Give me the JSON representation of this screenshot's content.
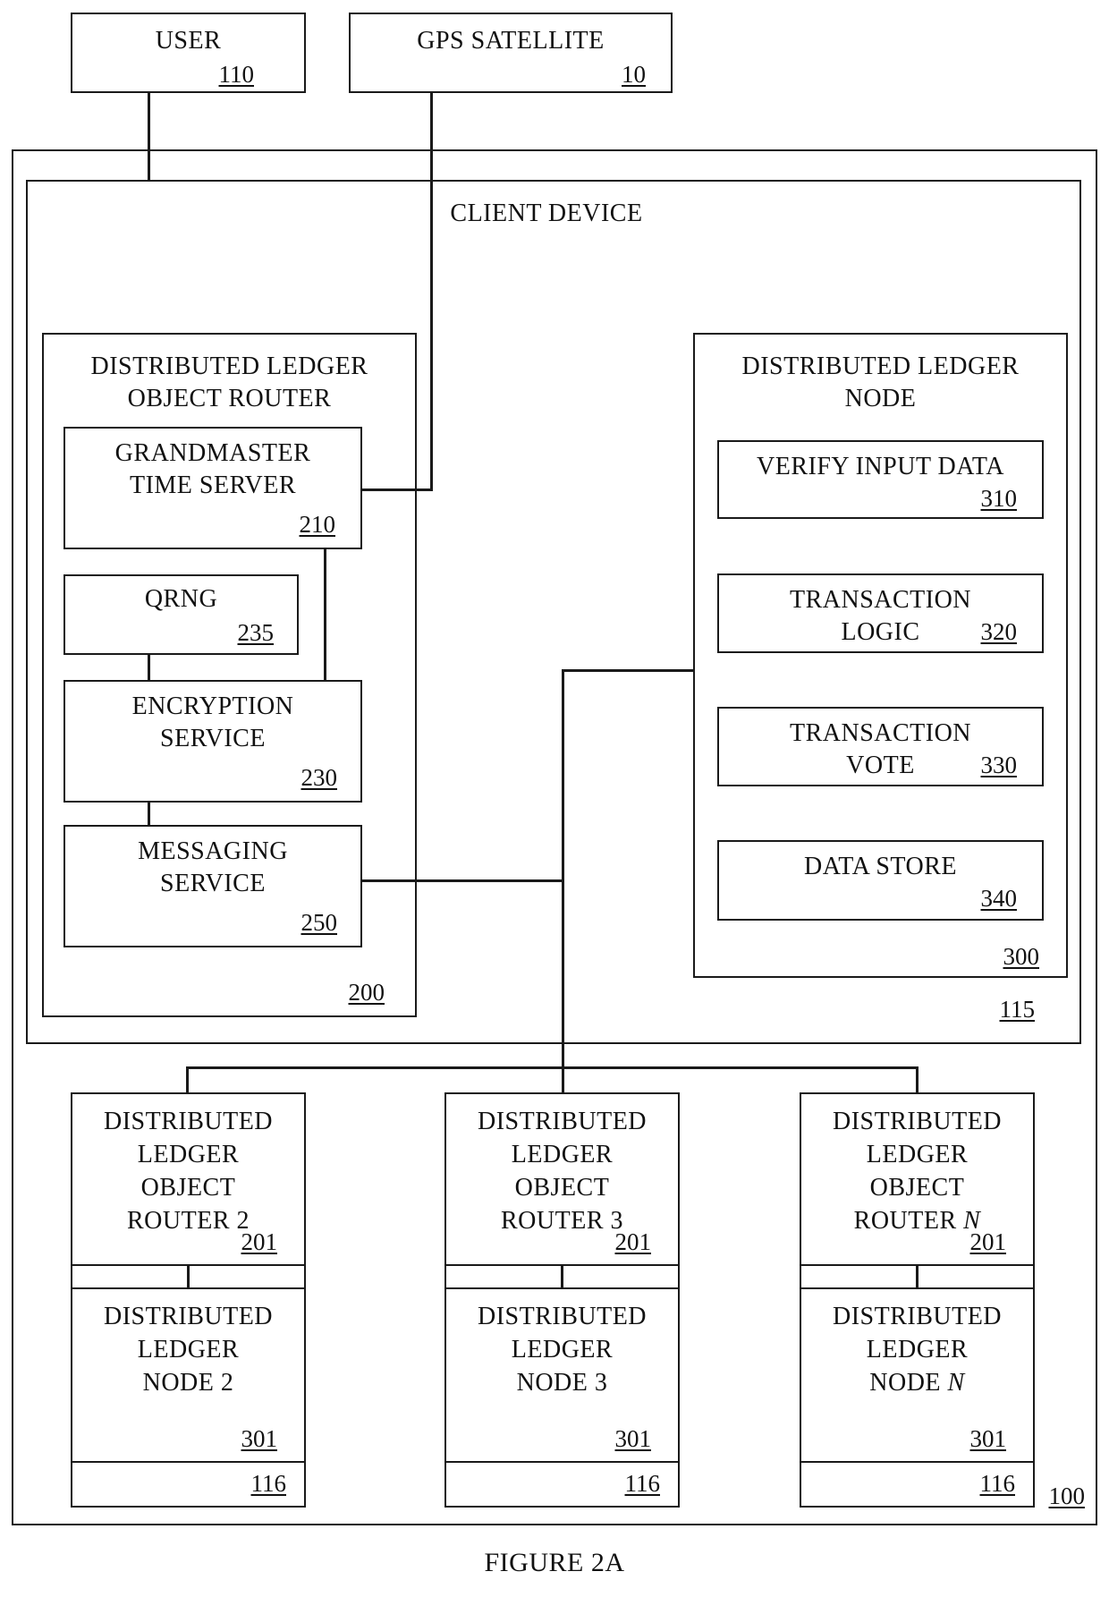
{
  "figure": {
    "caption": "FIGURE 2A"
  },
  "user": {
    "label": "USER",
    "ref": "110"
  },
  "gps": {
    "label": "GPS SATELLITE",
    "ref": "10"
  },
  "system": {
    "ref": "100"
  },
  "client_device": {
    "label": "CLIENT DEVICE",
    "ref": "115",
    "router": {
      "label": "DISTRIBUTED LEDGER\nOBJECT ROUTER",
      "ref": "200",
      "components": {
        "grandmaster": {
          "label": "GRANDMASTER\nTIME SERVER",
          "ref": "210"
        },
        "qrng": {
          "label": "QRNG",
          "ref": "235"
        },
        "encryption": {
          "label": "ENCRYPTION\nSERVICE",
          "ref": "230"
        },
        "messaging": {
          "label": "MESSAGING\nSERVICE",
          "ref": "250"
        }
      }
    },
    "node": {
      "label": "DISTRIBUTED LEDGER\nNODE",
      "ref": "300",
      "components": {
        "verify": {
          "label": "VERIFY INPUT DATA",
          "ref": "310"
        },
        "logic": {
          "label_line1": "TRANSACTION",
          "label_line2": "LOGIC",
          "ref": "320"
        },
        "vote": {
          "label_line1": "TRANSACTION",
          "label_line2": "VOTE",
          "ref": "330"
        },
        "datastore": {
          "label": "DATA STORE",
          "ref": "340"
        }
      }
    }
  },
  "peers": [
    {
      "router_prefix": "DISTRIBUTED\nLEDGER\nOBJECT\nROUTER ",
      "router_suffix": "2",
      "suffix_italic": false,
      "router_ref": "201",
      "node_prefix": "DISTRIBUTED\nLEDGER\nNODE ",
      "node_suffix": "2",
      "node_ref": "301",
      "device_ref": "116"
    },
    {
      "router_prefix": "DISTRIBUTED\nLEDGER\nOBJECT\nROUTER ",
      "router_suffix": "3",
      "suffix_italic": false,
      "router_ref": "201",
      "node_prefix": "DISTRIBUTED\nLEDGER\nNODE ",
      "node_suffix": "3",
      "node_ref": "301",
      "device_ref": "116"
    },
    {
      "router_prefix": "DISTRIBUTED\nLEDGER\nOBJECT\nROUTER ",
      "router_suffix": "N",
      "suffix_italic": true,
      "router_ref": "201",
      "node_prefix": "DISTRIBUTED\nLEDGER\nNODE ",
      "node_suffix": "N",
      "node_ref": "301",
      "device_ref": "116"
    }
  ]
}
